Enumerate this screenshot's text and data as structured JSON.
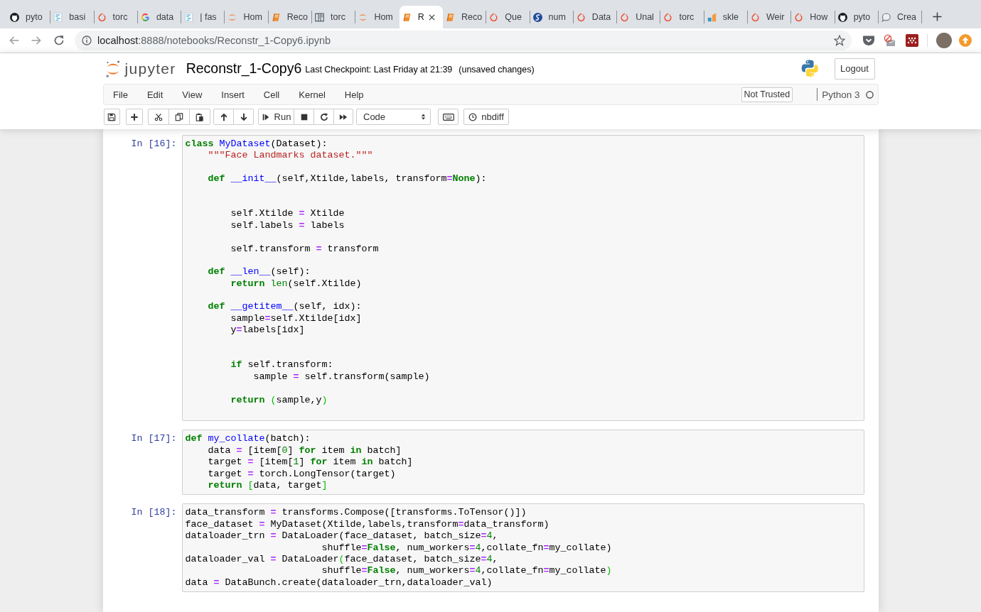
{
  "browser": {
    "tabs": [
      {
        "kind": "cat",
        "title": "pyto",
        "selected": false
      },
      {
        "kind": "doc",
        "title": "basi",
        "selected": false
      },
      {
        "kind": "flame",
        "title": "torc",
        "selected": false
      },
      {
        "kind": "g",
        "title": "data",
        "selected": false
      },
      {
        "kind": "doc",
        "title": "| fas",
        "selected": false
      },
      {
        "kind": "arcs",
        "title": "Hom",
        "selected": false
      },
      {
        "kind": "book",
        "title": "Reco",
        "selected": false
      },
      {
        "kind": "columns",
        "title": "torc",
        "selected": false
      },
      {
        "kind": "arcs",
        "title": "Hom",
        "selected": false
      },
      {
        "kind": "book",
        "title": "R",
        "selected": true
      },
      {
        "kind": "book",
        "title": "Reco",
        "selected": false
      },
      {
        "kind": "flame",
        "title": "Que",
        "selected": false
      },
      {
        "kind": "scircle",
        "title": "num",
        "selected": false
      },
      {
        "kind": "flame",
        "title": "Data",
        "selected": false
      },
      {
        "kind": "flame",
        "title": "Unal",
        "selected": false
      },
      {
        "kind": "flame",
        "title": "torc",
        "selected": false
      },
      {
        "kind": "bars",
        "title": "skle",
        "selected": false
      },
      {
        "kind": "flame",
        "title": "Weir",
        "selected": false
      },
      {
        "kind": "flame",
        "title": "How",
        "selected": false
      },
      {
        "kind": "cat",
        "title": "pyto",
        "selected": false
      },
      {
        "kind": "bubble",
        "title": "Crea",
        "selected": false
      }
    ],
    "url": {
      "host": "localhost",
      "path": ":8888/notebooks/Reconstr_1-Copy6.ipynb"
    }
  },
  "notebook": {
    "logo_text": "jupyter",
    "title": "Reconstr_1-Copy6",
    "checkpoint": "Last Checkpoint: Last Friday at 21:39",
    "save_state": "(unsaved changes)",
    "logout": "Logout",
    "menu": [
      "File",
      "Edit",
      "View",
      "Insert",
      "Cell",
      "Kernel",
      "Help"
    ],
    "trust": "Not Trusted",
    "kernel": {
      "name": "Python 3",
      "busy": false
    },
    "toolbar": {
      "run": "Run",
      "cell_type": "Code",
      "nbdiff": "nbdiff"
    },
    "cells": [
      {
        "prompt": "In [16]:",
        "lines": [
          {
            "kind": "code",
            "spans": [
              {
                "kind": "keyword",
                "text": "class "
              },
              {
                "kind": "definition",
                "text": "MyDataset"
              },
              {
                "kind": "plain",
                "text": "(Dataset):"
              }
            ]
          },
          {
            "kind": "code",
            "spans": [
              {
                "kind": "string",
                "text": "    \"\"\"Face Landmarks dataset.\"\"\""
              }
            ]
          },
          {
            "kind": "blank"
          },
          {
            "kind": "code",
            "spans": [
              {
                "kind": "keyword",
                "text": "    def "
              },
              {
                "kind": "definition",
                "text": "__init__"
              },
              {
                "kind": "plain",
                "text": "(self,Xtilde,labels, transform"
              },
              {
                "kind": "operator",
                "text": "="
              },
              {
                "kind": "keyword",
                "text": "None"
              },
              {
                "kind": "plain",
                "text": "):"
              }
            ]
          },
          {
            "kind": "blank"
          },
          {
            "kind": "blank"
          },
          {
            "kind": "code",
            "spans": [
              {
                "kind": "plain",
                "text": "        self.Xtilde "
              },
              {
                "kind": "operator",
                "text": "="
              },
              {
                "kind": "plain",
                "text": " Xtilde"
              }
            ]
          },
          {
            "kind": "code",
            "spans": [
              {
                "kind": "plain",
                "text": "        self.labels "
              },
              {
                "kind": "operator",
                "text": "="
              },
              {
                "kind": "plain",
                "text": " labels"
              }
            ]
          },
          {
            "kind": "blank"
          },
          {
            "kind": "code",
            "spans": [
              {
                "kind": "plain",
                "text": "        self.transform "
              },
              {
                "kind": "operator",
                "text": "="
              },
              {
                "kind": "plain",
                "text": " transform"
              }
            ]
          },
          {
            "kind": "blank"
          },
          {
            "kind": "code",
            "spans": [
              {
                "kind": "keyword",
                "text": "    def "
              },
              {
                "kind": "definition",
                "text": "__len__"
              },
              {
                "kind": "plain",
                "text": "(self):"
              }
            ]
          },
          {
            "kind": "code",
            "spans": [
              {
                "kind": "keyword",
                "text": "        return "
              },
              {
                "kind": "builtin",
                "text": "len"
              },
              {
                "kind": "plain",
                "text": "(self.Xtilde)"
              }
            ]
          },
          {
            "kind": "blank"
          },
          {
            "kind": "code",
            "spans": [
              {
                "kind": "keyword",
                "text": "    def "
              },
              {
                "kind": "definition",
                "text": "__getitem__"
              },
              {
                "kind": "plain",
                "text": "(self, idx):"
              }
            ]
          },
          {
            "kind": "code",
            "spans": [
              {
                "kind": "plain",
                "text": "        sample"
              },
              {
                "kind": "operator",
                "text": "="
              },
              {
                "kind": "plain",
                "text": "self.Xtilde[idx]"
              }
            ]
          },
          {
            "kind": "code",
            "spans": [
              {
                "kind": "plain",
                "text": "        y"
              },
              {
                "kind": "operator",
                "text": "="
              },
              {
                "kind": "plain",
                "text": "labels[idx]"
              }
            ]
          },
          {
            "kind": "blank"
          },
          {
            "kind": "blank"
          },
          {
            "kind": "code",
            "spans": [
              {
                "kind": "keyword",
                "text": "        if"
              },
              {
                "kind": "plain",
                "text": " self.transform:"
              }
            ]
          },
          {
            "kind": "code",
            "spans": [
              {
                "kind": "plain",
                "text": "            sample "
              },
              {
                "kind": "operator",
                "text": "="
              },
              {
                "kind": "plain",
                "text": " self.transform(sample)"
              }
            ]
          },
          {
            "kind": "blank"
          },
          {
            "kind": "code",
            "spans": [
              {
                "kind": "keyword",
                "text": "        return "
              },
              {
                "kind": "bracket",
                "text": "("
              },
              {
                "kind": "plain",
                "text": "sample,y"
              },
              {
                "kind": "bracket",
                "text": ")"
              }
            ]
          },
          {
            "kind": "blank"
          }
        ]
      },
      {
        "prompt": "In [17]:",
        "lines": [
          {
            "kind": "code",
            "spans": [
              {
                "kind": "keyword",
                "text": "def "
              },
              {
                "kind": "definition",
                "text": "my_collate"
              },
              {
                "kind": "plain",
                "text": "(batch):"
              }
            ]
          },
          {
            "kind": "code",
            "spans": [
              {
                "kind": "plain",
                "text": "    data "
              },
              {
                "kind": "operator",
                "text": "="
              },
              {
                "kind": "plain",
                "text": " [item["
              },
              {
                "kind": "number",
                "text": "0"
              },
              {
                "kind": "plain",
                "text": "] "
              },
              {
                "kind": "keyword",
                "text": "for"
              },
              {
                "kind": "plain",
                "text": " item "
              },
              {
                "kind": "keyword",
                "text": "in"
              },
              {
                "kind": "plain",
                "text": " batch]"
              }
            ]
          },
          {
            "kind": "code",
            "spans": [
              {
                "kind": "plain",
                "text": "    target "
              },
              {
                "kind": "operator",
                "text": "="
              },
              {
                "kind": "plain",
                "text": " [item["
              },
              {
                "kind": "number",
                "text": "1"
              },
              {
                "kind": "plain",
                "text": "] "
              },
              {
                "kind": "keyword",
                "text": "for"
              },
              {
                "kind": "plain",
                "text": " item "
              },
              {
                "kind": "keyword",
                "text": "in"
              },
              {
                "kind": "plain",
                "text": " batch]"
              }
            ]
          },
          {
            "kind": "code",
            "spans": [
              {
                "kind": "plain",
                "text": "    target "
              },
              {
                "kind": "operator",
                "text": "="
              },
              {
                "kind": "plain",
                "text": " torch.LongTensor(target)"
              }
            ]
          },
          {
            "kind": "code",
            "spans": [
              {
                "kind": "keyword",
                "text": "    return "
              },
              {
                "kind": "bracket",
                "text": "["
              },
              {
                "kind": "plain",
                "text": "data, target"
              },
              {
                "kind": "bracket",
                "text": "]"
              }
            ]
          }
        ]
      },
      {
        "prompt": "In [18]:",
        "lines": [
          {
            "kind": "code",
            "spans": [
              {
                "kind": "plain",
                "text": "data_transform "
              },
              {
                "kind": "operator",
                "text": "="
              },
              {
                "kind": "plain",
                "text": " transforms.Compose([transforms.ToTensor()])"
              }
            ]
          },
          {
            "kind": "code",
            "spans": [
              {
                "kind": "plain",
                "text": "face_dataset "
              },
              {
                "kind": "operator",
                "text": "="
              },
              {
                "kind": "plain",
                "text": " MyDataset(Xtilde,labels,transform"
              },
              {
                "kind": "operator",
                "text": "="
              },
              {
                "kind": "plain",
                "text": "data_transform)"
              }
            ]
          },
          {
            "kind": "code",
            "spans": [
              {
                "kind": "plain",
                "text": "dataloader_trn "
              },
              {
                "kind": "operator",
                "text": "="
              },
              {
                "kind": "plain",
                "text": " DataLoader(face_dataset, batch_size"
              },
              {
                "kind": "operator",
                "text": "="
              },
              {
                "kind": "number",
                "text": "4"
              },
              {
                "kind": "plain",
                "text": ","
              }
            ]
          },
          {
            "kind": "code",
            "spans": [
              {
                "kind": "plain",
                "text": "                        shuffle"
              },
              {
                "kind": "operator",
                "text": "="
              },
              {
                "kind": "keyword",
                "text": "False"
              },
              {
                "kind": "plain",
                "text": ", num_workers"
              },
              {
                "kind": "operator",
                "text": "="
              },
              {
                "kind": "number",
                "text": "4"
              },
              {
                "kind": "plain",
                "text": ",collate_fn"
              },
              {
                "kind": "operator",
                "text": "="
              },
              {
                "kind": "plain",
                "text": "my_collate)"
              }
            ]
          },
          {
            "kind": "code",
            "spans": [
              {
                "kind": "plain",
                "text": "dataloader_val "
              },
              {
                "kind": "operator",
                "text": "="
              },
              {
                "kind": "plain",
                "text": " DataLoader"
              },
              {
                "kind": "bracket",
                "text": "("
              },
              {
                "kind": "plain",
                "text": "face_dataset, batch_size"
              },
              {
                "kind": "operator",
                "text": "="
              },
              {
                "kind": "number",
                "text": "4"
              },
              {
                "kind": "plain",
                "text": ","
              }
            ]
          },
          {
            "kind": "code",
            "spans": [
              {
                "kind": "plain",
                "text": "                        shuffle"
              },
              {
                "kind": "operator",
                "text": "="
              },
              {
                "kind": "keyword",
                "text": "False"
              },
              {
                "kind": "plain",
                "text": ", num_workers"
              },
              {
                "kind": "operator",
                "text": "="
              },
              {
                "kind": "number",
                "text": "4"
              },
              {
                "kind": "plain",
                "text": ",collate_fn"
              },
              {
                "kind": "operator",
                "text": "="
              },
              {
                "kind": "plain",
                "text": "my_collate"
              },
              {
                "kind": "bracket",
                "text": ")"
              }
            ]
          },
          {
            "kind": "code",
            "spans": [
              {
                "kind": "plain",
                "text": "data "
              },
              {
                "kind": "operator",
                "text": "="
              },
              {
                "kind": "plain",
                "text": " DataBunch.create(dataloader_trn,dataloader_val)"
              }
            ]
          }
        ]
      }
    ]
  }
}
